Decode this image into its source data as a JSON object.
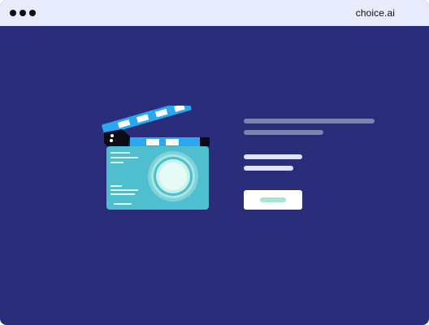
{
  "window": {
    "brand": "choice.ai",
    "background": "#2a2d7a",
    "titlebar_color": "#e8ebfc"
  },
  "illustration": {
    "icon": "clapperboard-camera-icon",
    "body_color": "#4fbfcf",
    "stripe_color": "#2aa7f0",
    "lens_color": "#e6fbf5"
  },
  "placeholder_lines": {
    "heading_color": "#7a85ad",
    "body_color": "#dde3ff"
  },
  "cta": {
    "icon": "placeholder-text-bar",
    "fill_color": "#a8e6d4"
  }
}
